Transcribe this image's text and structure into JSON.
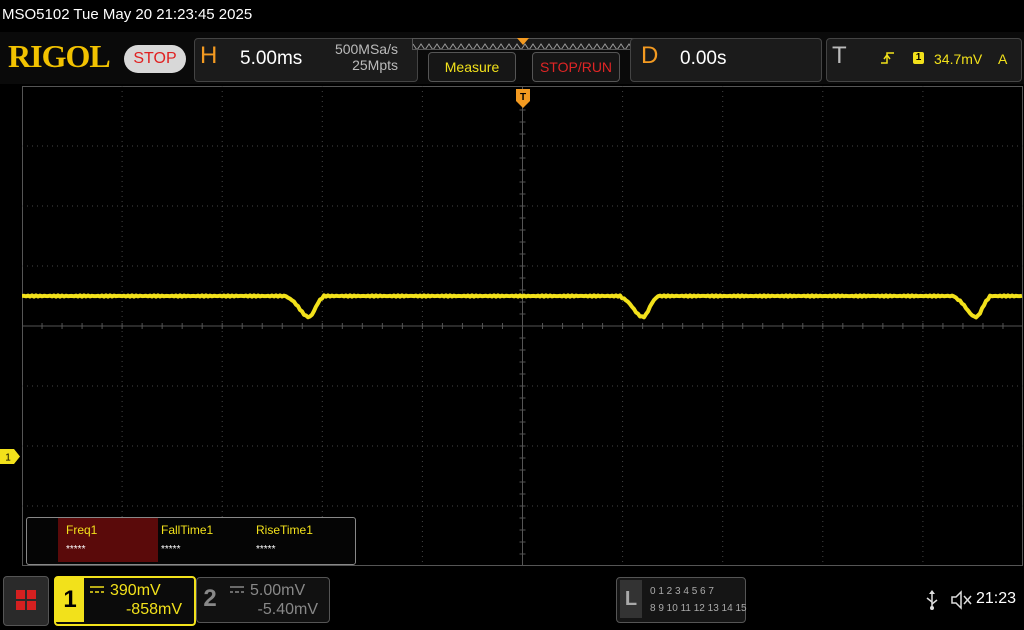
{
  "titlebar": {
    "text": "MSO5102  Tue May 20 21:23:45 2025"
  },
  "header": {
    "logo": "RIGOL",
    "run_state": "STOP",
    "horizontal": {
      "letter": "H",
      "timebase": "5.00ms",
      "sample_rate": "500MSa/s",
      "memory_depth": "25Mpts"
    },
    "measure_label": "Measure",
    "stoprun_label": "STOP/RUN",
    "delay": {
      "letter": "D",
      "value": "0.00s"
    },
    "trigger": {
      "letter": "T",
      "channel": "1",
      "level": "34.7mV",
      "mode": "A"
    }
  },
  "measurements": [
    {
      "name": "Freq1",
      "value": "*****"
    },
    {
      "name": "FallTime1",
      "value": "*****"
    },
    {
      "name": "RiseTime1",
      "value": "*****"
    }
  ],
  "channel_marker": "1",
  "channel1": {
    "number": "1",
    "scale": "390mV",
    "offset": "-858mV",
    "color": "#f2e11b"
  },
  "channel2": {
    "number": "2",
    "scale": "5.00mV",
    "offset": "-5.40mV",
    "color": "#888888"
  },
  "logic_analyzer": {
    "letter": "L",
    "row1": "0 1 2 3   4 5 6 7",
    "row2": "8 9 10 11  12 13 14 15"
  },
  "status": {
    "time": "21:23"
  },
  "icons": {
    "home": "home-menu-icon",
    "usb": "usb-icon",
    "sound": "speaker-muted-icon",
    "trigger_edge": "rising-edge-icon"
  },
  "colors": {
    "trace": "#f2e11b",
    "accent_orange": "#f39a21",
    "stop_red": "#e02020"
  }
}
